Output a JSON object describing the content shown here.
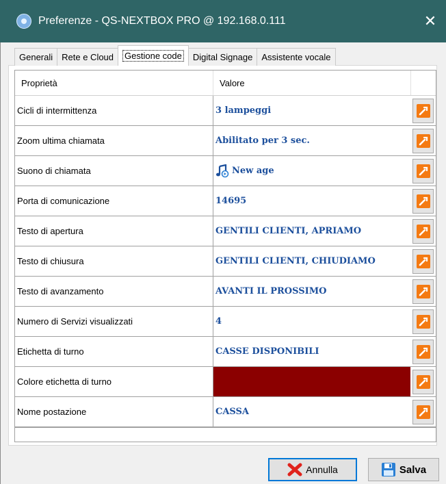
{
  "window": {
    "title": "Preferenze - QS-NEXTBOX PRO @ 192.168.0.111",
    "close_glyph": "✕"
  },
  "tabs": [
    {
      "label": "Generali",
      "active": false
    },
    {
      "label": "Rete e Cloud",
      "active": false
    },
    {
      "label": "Gestione code",
      "active": true
    },
    {
      "label": "Digital Signage",
      "active": false
    },
    {
      "label": "Assistente vocale",
      "active": false
    }
  ],
  "grid": {
    "col_property": "Proprietà",
    "col_value": "Valore",
    "rows": [
      {
        "property": "Cicli di intermittenza",
        "value": "3 lampeggi"
      },
      {
        "property": "Zoom ultima chiamata",
        "value": "Abilitato per 3 sec."
      },
      {
        "property": "Suono di chiamata",
        "value": "New age",
        "icon": "music-note-icon"
      },
      {
        "property": "Porta di comunicazione",
        "value": "14695"
      },
      {
        "property": "Testo di apertura",
        "value": "GENTILI CLIENTI, APRIAMO"
      },
      {
        "property": "Testo di chiusura",
        "value": "GENTILI CLIENTI, CHIUDIAMO"
      },
      {
        "property": "Testo di avanzamento",
        "value": "AVANTI IL PROSSIMO"
      },
      {
        "property": "Numero di Servizi visualizzati",
        "value": "4"
      },
      {
        "property": "Etichetta di turno",
        "value": "CASSE DISPONIBILI"
      },
      {
        "property": "Colore etichetta di turno",
        "value": "",
        "color": "#8b0000"
      },
      {
        "property": "Nome postazione",
        "value": "CASSA"
      }
    ]
  },
  "buttons": {
    "cancel": "Annulla",
    "save": "Salva"
  },
  "colors": {
    "titlebar": "#2f6566",
    "value_text": "#1c4f9c",
    "edit_icon": "#f47a12",
    "cancel_icon": "#e0231c",
    "save_icon": "#2a7fd4"
  }
}
